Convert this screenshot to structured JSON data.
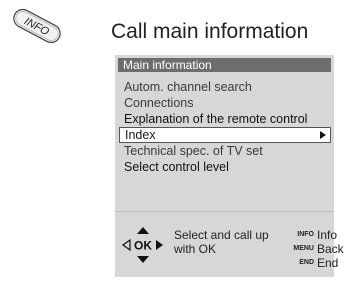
{
  "heading": "Call main information",
  "info_key_label": "INFO",
  "osd": {
    "title": "Main information",
    "items": [
      {
        "label": "Autom. channel search",
        "style": "grey"
      },
      {
        "label": "Connections",
        "style": "grey"
      },
      {
        "label": "Explanation of the remote control",
        "style": "black"
      },
      {
        "label": "Index",
        "style": "active"
      },
      {
        "label": "Technical spec. of TV set",
        "style": "grey"
      },
      {
        "label": "Select control level",
        "style": "black"
      }
    ],
    "ok_label": "OK",
    "help_text": "Select and call up with OK",
    "legend": [
      {
        "key": "INFO",
        "action": "Info"
      },
      {
        "key": "MENU",
        "action": "Back"
      },
      {
        "key": "END",
        "action": "End"
      }
    ]
  }
}
